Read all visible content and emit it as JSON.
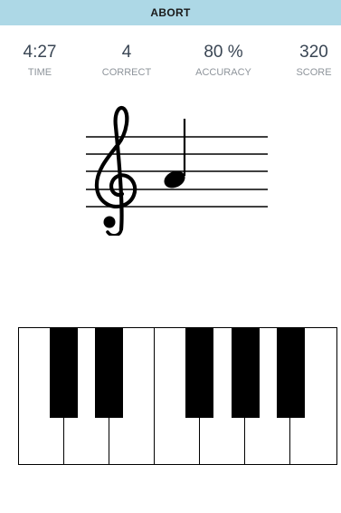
{
  "top_bar": {
    "label": "ABORT",
    "color": "#add8e6"
  },
  "stats": [
    {
      "value": "4:27",
      "label": "TIME"
    },
    {
      "value": "4",
      "label": "CORRECT"
    },
    {
      "value": "80 %",
      "label": "ACCURACY"
    },
    {
      "value": "320",
      "label": "SCORE"
    }
  ],
  "staff": {
    "clef": "treble-clef-icon",
    "note": "quarter-note-icon"
  },
  "piano": {
    "white_keys": 7,
    "black_keys": 5
  }
}
